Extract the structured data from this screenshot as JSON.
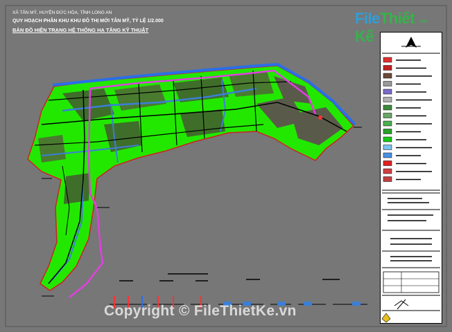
{
  "header": {
    "line1": "XÃ TÂN MỸ, HUYỆN ĐỨC HÒA, TỈNH LONG AN",
    "line2": "QUY HOẠCH PHÂN KHU KHU ĐÔ THỊ MỚI TÂN MỸ, TỶ LỆ 1/2.000",
    "line3": "BẢN ĐỒ HIỆN TRẠNG HỆ THỐNG HẠ TẦNG KỸ THUẬT"
  },
  "logo": {
    "part1": "File",
    "part2": "Thiết Kế",
    "suffix": ".vn"
  },
  "watermark": "Copyright © FileThietKe.vn",
  "colors": {
    "background": "#777777",
    "vegetation": "#22e800",
    "vegetation_dark": "#3f6e2a",
    "built_area": "#5a5a4a",
    "water": "#3b7fd6",
    "project_boundary": "#e040e0",
    "roads": "#000000",
    "lot_boundary": "#d02020",
    "legend_bg": "#ffffff"
  },
  "legend": {
    "swatch_colors": [
      "#e03030",
      "#c02020",
      "#6a4a3a",
      "#9a9a9a",
      "#7a6cc8",
      "#b0b0b0",
      "#3c8a3c",
      "#6aa66a",
      "#4caf50",
      "#2aa02a",
      "#18c818",
      "#7ec0ee",
      "#4a90e2",
      "#e02020",
      "#d04040",
      "#c04040"
    ]
  }
}
